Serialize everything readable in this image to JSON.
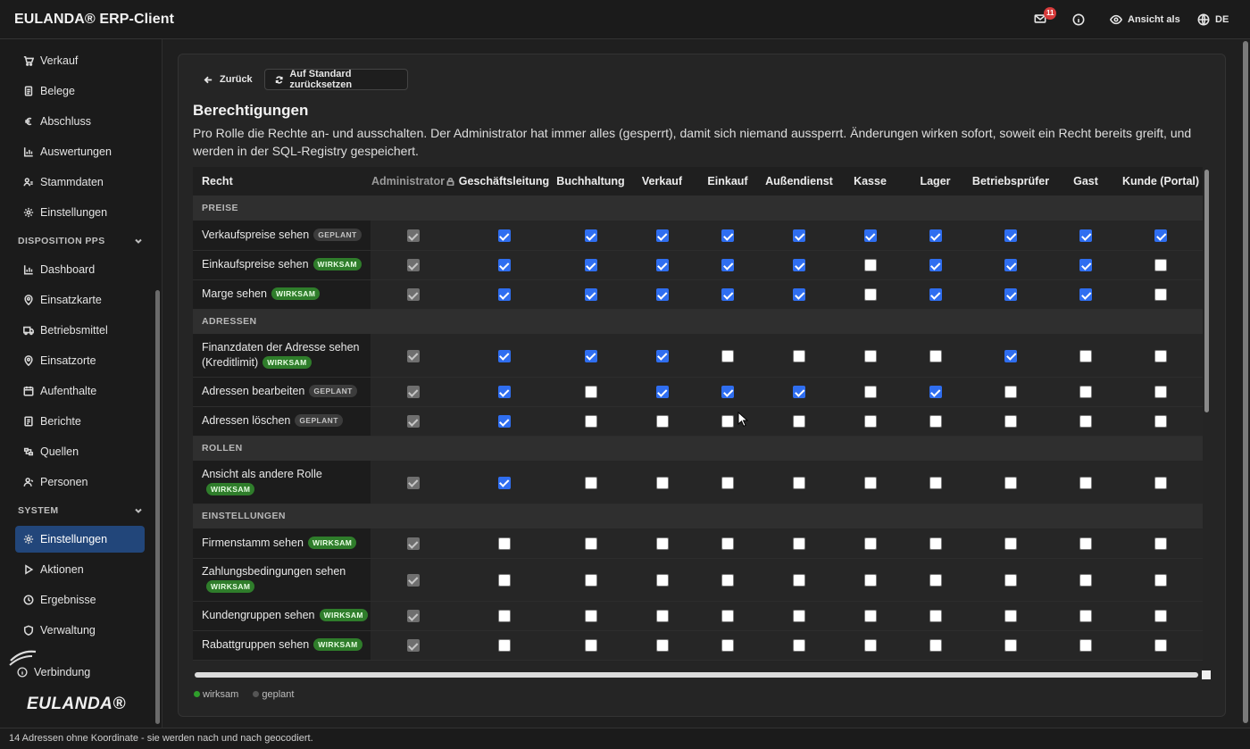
{
  "header": {
    "app_title": "EULANDA® ERP-Client",
    "mail_count": "11",
    "view_as_label": "Ansicht als",
    "language": "DE"
  },
  "sidebar": {
    "items_top": [
      {
        "label": "Verkauf",
        "icon": "cart-icon"
      },
      {
        "label": "Belege",
        "icon": "document-icon"
      },
      {
        "label": "Abschluss",
        "icon": "euro-icon"
      },
      {
        "label": "Auswertungen",
        "icon": "bar-chart-icon"
      },
      {
        "label": "Stammdaten",
        "icon": "user-list-icon"
      },
      {
        "label": "Einstellungen",
        "icon": "gear-icon"
      }
    ],
    "section_pps": "DISPOSITION PPS",
    "items_pps": [
      {
        "label": "Dashboard",
        "icon": "bar-chart-icon"
      },
      {
        "label": "Einsatzkarte",
        "icon": "map-pin-icon"
      },
      {
        "label": "Betriebsmittel",
        "icon": "truck-icon"
      },
      {
        "label": "Einsatzorte",
        "icon": "map-pin-icon"
      },
      {
        "label": "Aufenthalte",
        "icon": "calendar-icon"
      },
      {
        "label": "Berichte",
        "icon": "report-icon"
      },
      {
        "label": "Quellen",
        "icon": "source-icon"
      },
      {
        "label": "Personen",
        "icon": "person-icon"
      }
    ],
    "section_system": "SYSTEM",
    "items_system": [
      {
        "label": "Einstellungen",
        "icon": "gear-icon"
      },
      {
        "label": "Aktionen",
        "icon": "play-icon"
      },
      {
        "label": "Ergebnisse",
        "icon": "clock-icon"
      },
      {
        "label": "Verwaltung",
        "icon": "shield-icon"
      }
    ],
    "connection_label": "Verbindung",
    "logo_text": "EULANDA®"
  },
  "toolbar": {
    "back_label": "Zurück",
    "reset_label": "Auf Standard zurücksetzen"
  },
  "page": {
    "title": "Berechtigungen",
    "description": "Pro Rolle die Rechte an- und ausschalten. Der Administrator hat immer alles (gesperrt), damit sich niemand aussperrt. Änderungen wirken sofort, soweit ein Recht bereits greift, und werden in der SQL-Registry gespeichert."
  },
  "table": {
    "columns": [
      "Recht",
      "Administrator",
      "Geschäftsleitung",
      "Buchhaltung",
      "Verkauf",
      "Einkauf",
      "Außendienst",
      "Kasse",
      "Lager",
      "Betriebsprüfer",
      "Gast",
      "Kunde (Portal)"
    ],
    "sections": [
      {
        "title": "PREISE",
        "rows": [
          {
            "name": "Verkaufspreise sehen",
            "status": "GEPLANT",
            "values": [
              1,
              1,
              1,
              1,
              1,
              1,
              1,
              1,
              1,
              1
            ]
          },
          {
            "name": "Einkaufspreise sehen",
            "status": "WIRKSAM",
            "values": [
              1,
              1,
              1,
              1,
              1,
              0,
              1,
              1,
              1,
              0
            ]
          },
          {
            "name": "Marge sehen",
            "status": "WIRKSAM",
            "values": [
              1,
              1,
              1,
              1,
              1,
              0,
              1,
              1,
              1,
              0
            ]
          }
        ]
      },
      {
        "title": "ADRESSEN",
        "rows": [
          {
            "name": "Finanzdaten der Adresse sehen (Kreditlimit)",
            "status": "WIRKSAM",
            "values": [
              1,
              1,
              1,
              0,
              0,
              0,
              0,
              1,
              0,
              0
            ]
          },
          {
            "name": "Adressen bearbeiten",
            "status": "GEPLANT",
            "values": [
              1,
              0,
              1,
              1,
              1,
              0,
              1,
              0,
              0,
              0
            ]
          },
          {
            "name": "Adressen löschen",
            "status": "GEPLANT",
            "values": [
              1,
              0,
              0,
              0,
              0,
              0,
              0,
              0,
              0,
              0
            ]
          }
        ]
      },
      {
        "title": "ROLLEN",
        "rows": [
          {
            "name": "Ansicht als andere Rolle",
            "status": "WIRKSAM",
            "values": [
              1,
              0,
              0,
              0,
              0,
              0,
              0,
              0,
              0,
              0
            ]
          }
        ]
      },
      {
        "title": "EINSTELLUNGEN",
        "rows": [
          {
            "name": "Firmenstamm sehen",
            "status": "WIRKSAM",
            "values": [
              0,
              0,
              0,
              0,
              0,
              0,
              0,
              0,
              0,
              0
            ]
          },
          {
            "name": "Zahlungsbedingungen sehen",
            "status": "WIRKSAM",
            "values": [
              0,
              0,
              0,
              0,
              0,
              0,
              0,
              0,
              0,
              0
            ]
          },
          {
            "name": "Kundengruppen sehen",
            "status": "WIRKSAM",
            "values": [
              0,
              0,
              0,
              0,
              0,
              0,
              0,
              0,
              0,
              0
            ]
          },
          {
            "name": "Rabattgruppen sehen",
            "status": "WIRKSAM",
            "values": [
              0,
              0,
              0,
              0,
              0,
              0,
              0,
              0,
              0,
              0
            ]
          }
        ]
      }
    ]
  },
  "legend": {
    "wirksam_label": "wirksam",
    "geplant_label": "geplant",
    "wirksam_color": "#2f9e2b",
    "geplant_color": "#555555"
  },
  "status_bar": {
    "message": "14 Adressen ohne Koordinate - sie werden nach und nach geocodiert."
  },
  "colors": {
    "accent": "#2f6ef0",
    "active_nav": "#22467a",
    "wirksam_tag": "#2f7d2b",
    "geplant_tag": "#3c3c3c"
  }
}
